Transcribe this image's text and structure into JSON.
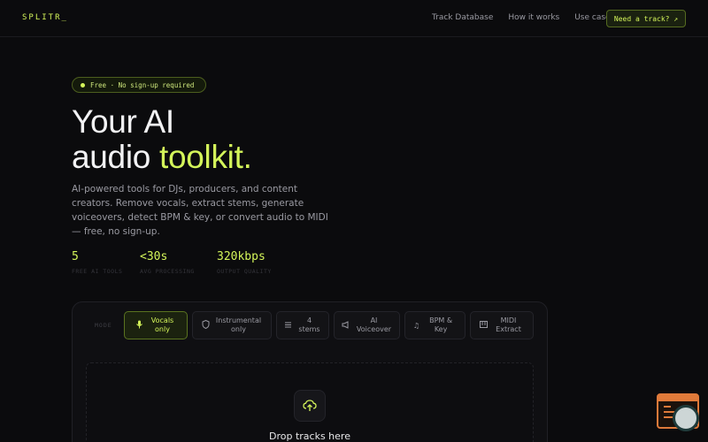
{
  "nav": {
    "logo": "SPLITR_",
    "links": [
      "Track Database",
      "How it works",
      "Use cases"
    ],
    "cta": "Need a track? ↗"
  },
  "badge": "Free · No sign-up required",
  "hero": {
    "title_line1": "Your AI",
    "title_line2_plain": "audio ",
    "title_line2_accent": "toolkit.",
    "description": "AI-powered tools for DJs, producers, and content creators. Remove vocals, extract stems, generate voiceovers, detect BPM & key, or convert audio to MIDI — free, no sign-up."
  },
  "stats": [
    {
      "value": "5",
      "label": "FREE AI TOOLS"
    },
    {
      "value": "<30s",
      "label": "AVG PROCESSING"
    },
    {
      "value": "320kbps",
      "label": "OUTPUT QUALITY"
    }
  ],
  "tool": {
    "mode_label": "MODE",
    "modes": [
      {
        "label": "Vocals only",
        "icon": "mic-icon"
      },
      {
        "label": "Instrumental only",
        "icon": "shield-icon"
      },
      {
        "label": "4 stems",
        "icon": "layers-icon"
      },
      {
        "label": "AI Voiceover",
        "icon": "megaphone-icon"
      },
      {
        "label": "BPM & Key",
        "icon": "music-note-icon"
      },
      {
        "label": "MIDI Extract",
        "icon": "piano-icon"
      }
    ],
    "active_mode": "Vocals only",
    "drop_text": "Drop tracks here"
  },
  "colors": {
    "accent": "#d4f55a",
    "background": "#0b0b0d",
    "widget": "#e07a3a"
  }
}
